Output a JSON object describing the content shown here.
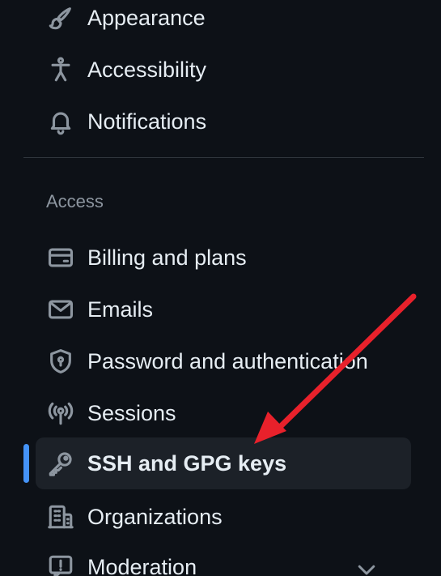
{
  "nav": {
    "top_items": [
      {
        "label": "Appearance",
        "icon": "paintbrush-icon"
      },
      {
        "label": "Accessibility",
        "icon": "accessibility-icon"
      },
      {
        "label": "Notifications",
        "icon": "bell-icon"
      }
    ],
    "access_section": {
      "heading": "Access",
      "items": [
        {
          "label": "Billing and plans",
          "icon": "credit-card-icon"
        },
        {
          "label": "Emails",
          "icon": "mail-icon"
        },
        {
          "label": "Password and authentication",
          "icon": "shield-lock-icon"
        },
        {
          "label": "Sessions",
          "icon": "broadcast-icon"
        },
        {
          "label": "SSH and GPG keys",
          "icon": "key-icon",
          "active": true
        },
        {
          "label": "Organizations",
          "icon": "organization-icon"
        },
        {
          "label": "Moderation",
          "icon": "report-icon",
          "expandable": true
        }
      ]
    }
  },
  "colors": {
    "background": "#0d1117",
    "active_background": "#1c2128",
    "active_indicator": "#4493f8",
    "text": "#e6edf3",
    "muted": "#8d96a0",
    "divider": "#30363d",
    "annotation_arrow": "#e8212b"
  }
}
